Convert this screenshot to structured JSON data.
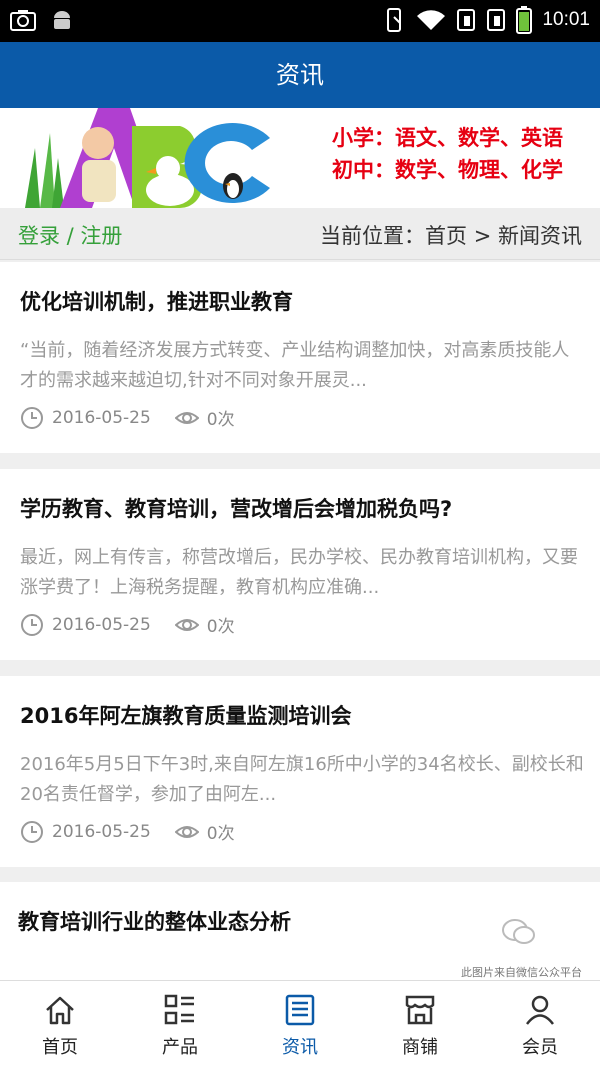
{
  "status_bar": {
    "time": "10:01"
  },
  "app_bar": {
    "title": "资讯"
  },
  "banner": {
    "line1": "小学：语文、数学、英语",
    "line2": "初中：数学、物理、化学"
  },
  "breadcrumb": {
    "login": "登录 / 注册",
    "position": "当前位置：首页 > 新闻资讯"
  },
  "news": [
    {
      "title": "优化培训机制，推进职业教育",
      "summary": "“当前，随着经济发展方式转变、产业结构调整加快，对高素质技能人才的需求越来越迫切,针对不同对象开展灵...",
      "date": "2016-05-25",
      "views": "0次"
    },
    {
      "title": "学历教育、教育培训，营改增后会增加税负吗?",
      "summary": "最近，网上有传言，称营改增后，民办学校、民办教育培训机构，又要涨学费了！上海税务提醒，教育机构应准确...",
      "date": "2016-05-25",
      "views": "0次"
    },
    {
      "title": "2016年阿左旗教育质量监测培训会",
      "summary": "2016年5月5日下午3时,来自阿左旗16所中小学的34名校长、副校长和20名责任督学，参加了由阿左...",
      "date": "2016-05-25",
      "views": "0次"
    },
    {
      "title": "教育培训行业的整体业态分析"
    }
  ],
  "watermark": "此图片来自微信公众平台",
  "bottom_nav": [
    {
      "label": "首页",
      "icon": "home-icon"
    },
    {
      "label": "产品",
      "icon": "grid-list-icon"
    },
    {
      "label": "资讯",
      "icon": "news-icon",
      "active": true
    },
    {
      "label": "商铺",
      "icon": "shop-icon"
    },
    {
      "label": "会员",
      "icon": "user-icon"
    }
  ],
  "colors": {
    "primary": "#0b5aa8",
    "login": "#35a03a",
    "banner_text": "#e60012"
  }
}
